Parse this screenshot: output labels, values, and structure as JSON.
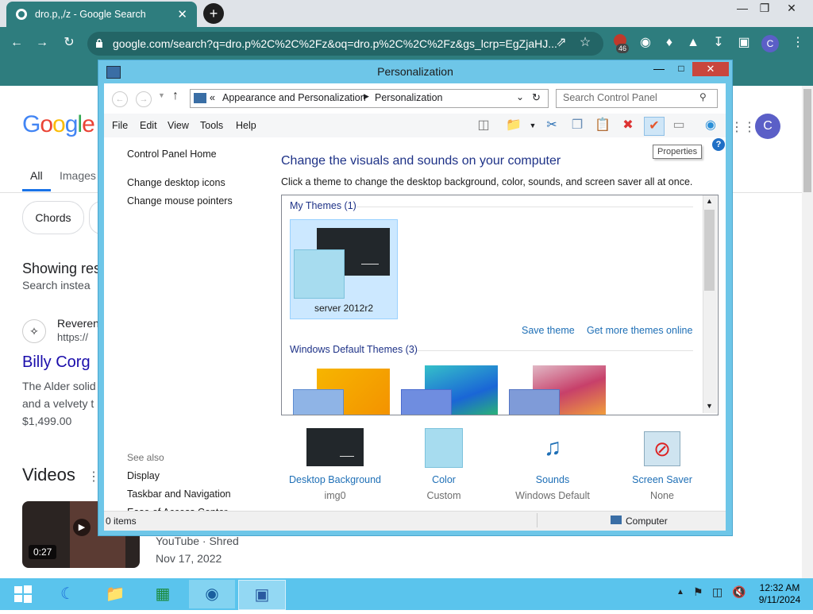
{
  "browser": {
    "tab_title": "dro.p,,/z - Google Search",
    "tab_close": "✕",
    "new_tab": "+",
    "url": "google.com/search?q=dro.p%2C%2C%2Fz&oq=dro.p%2C%2C%2Fz&gs_lcrp=EgZjaHJ...",
    "profile_initial": "C",
    "badge_count": "46",
    "window_min": "—",
    "window_max": "❐",
    "window_close": "✕"
  },
  "google": {
    "logo": "Google",
    "nav": {
      "all": "All",
      "images": "Images"
    },
    "chips": [
      "Chords"
    ],
    "showing": "Showing res",
    "search_instead": "Search instea",
    "result": {
      "site_name": "Reveren",
      "site_url": "https://",
      "title": "Billy Corg",
      "snippet_1": "The Alder solid",
      "snippet_2": "and a velvety t",
      "price": "$1,499.00"
    },
    "videos_heading": "Videos",
    "video": {
      "duration": "0:27",
      "source": "YouTube · Shred",
      "date": "Nov 17, 2022"
    },
    "profile_initial": "C"
  },
  "window": {
    "title": "Personalization",
    "address": {
      "prefix": "«",
      "crumb_1": "Appearance and Personalization",
      "crumb_2": "Personalization"
    },
    "search_placeholder": "Search Control Panel",
    "menu": [
      "File",
      "Edit",
      "View",
      "Tools",
      "Help"
    ],
    "tooltip": "Properties",
    "left_links": [
      "Control Panel Home",
      "Change desktop icons",
      "Change mouse pointers"
    ],
    "see_also_heading": "See also",
    "see_also": [
      "Display",
      "Taskbar and Navigation",
      "Ease of Access Center"
    ],
    "heading": "Change the visuals and sounds on your computer",
    "description": "Click a theme to change the desktop background, color, sounds, and screen saver all at once.",
    "my_themes_label": "My Themes (1)",
    "selected_theme_name": "server 2012r2",
    "save_theme": "Save theme",
    "more_themes": "Get more themes online",
    "default_themes_label": "Windows Default Themes (3)",
    "bottom": [
      {
        "label": "Desktop Background",
        "value": "img0"
      },
      {
        "label": "Color",
        "value": "Custom"
      },
      {
        "label": "Sounds",
        "value": "Windows Default"
      },
      {
        "label": "Screen Saver",
        "value": "None"
      }
    ],
    "status_items": "0 items",
    "status_location": "Computer"
  },
  "taskbar": {
    "time": "12:32 AM",
    "date": "9/11/2024"
  },
  "colors": {
    "chrome_teal": "#2e7d7e",
    "taskbar": "#5ac4ed",
    "window_frame": "#6ec6e8",
    "link_blue": "#1e6fb6",
    "heading_blue": "#1e3287"
  }
}
